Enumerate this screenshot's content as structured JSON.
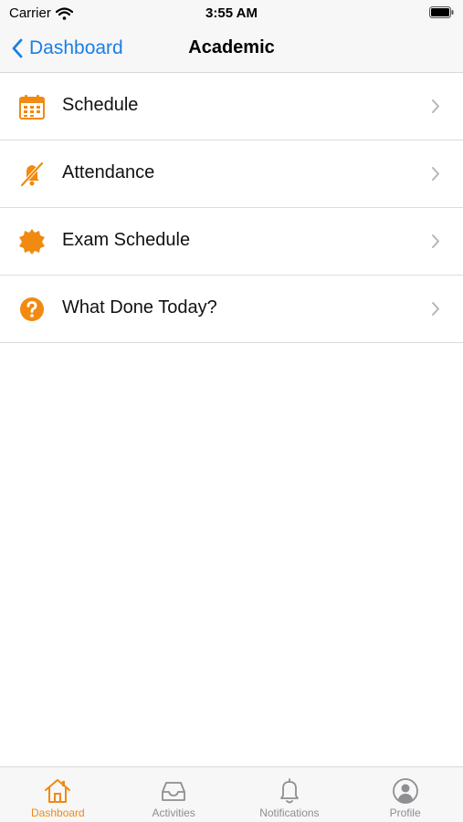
{
  "status": {
    "carrier": "Carrier",
    "time": "3:55 AM"
  },
  "nav": {
    "back_label": "Dashboard",
    "title": "Academic"
  },
  "menu": [
    {
      "label": "Schedule",
      "icon": "calendar-icon"
    },
    {
      "label": "Attendance",
      "icon": "bell-slash-icon"
    },
    {
      "label": "Exam Schedule",
      "icon": "badge-icon"
    },
    {
      "label": "What Done Today?",
      "icon": "question-circle-icon"
    }
  ],
  "tabs": [
    {
      "label": "Dashboard",
      "icon": "home-icon",
      "active": true
    },
    {
      "label": "Activities",
      "icon": "inbox-icon",
      "active": false
    },
    {
      "label": "Notifications",
      "icon": "bell-icon",
      "active": false
    },
    {
      "label": "Profile",
      "icon": "user-circle-icon",
      "active": false
    }
  ],
  "colors": {
    "accent": "#f08a10",
    "link": "#1a7ee6",
    "inactive": "#8e8e93"
  }
}
